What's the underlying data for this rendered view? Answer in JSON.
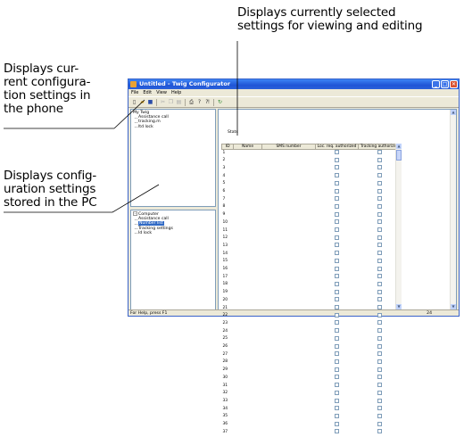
{
  "callouts": {
    "top": [
      "Displays currently selected",
      "settings for viewing and editing"
    ],
    "left1": [
      "Displays cur-",
      "rent configura-",
      "tion settings in",
      "the phone"
    ],
    "left2": [
      "Displays config-",
      "uration settings",
      "stored in the PC"
    ]
  },
  "window": {
    "title": "Untitled - Twig Configurator",
    "controls": {
      "minimize": "_",
      "maximize": "□",
      "close": "✕"
    },
    "menu": [
      "File",
      "Edit",
      "View",
      "Help"
    ],
    "toolbar_icons": [
      "new-file-icon",
      "open-folder-icon",
      "save-icon",
      "cut-icon",
      "copy-icon",
      "paste-icon",
      "print-icon",
      "help-icon",
      "context-help-icon",
      "refresh-icon"
    ]
  },
  "tree_phone": {
    "root": "My Twig",
    "items": [
      "Assistance call",
      "tracking.m",
      "ltd lock"
    ]
  },
  "tree_pc": {
    "root": "Computer",
    "items": [
      "Assistance call",
      "Number list",
      "Tracking settings",
      "Id lock"
    ],
    "selected_index": 1
  },
  "detail": {
    "tab_label": "Stats",
    "columns": [
      "ID",
      "Name",
      "SMS number",
      "Loc. req. authorized",
      "Tracking authorized"
    ],
    "row_ids": [
      "1",
      "2",
      "3",
      "4",
      "5",
      "6",
      "7",
      "8",
      "9",
      "10",
      "11",
      "12",
      "13",
      "14",
      "15",
      "16",
      "17",
      "18",
      "19",
      "20",
      "21",
      "22",
      "23",
      "24",
      "25",
      "26",
      "27",
      "28",
      "29",
      "30",
      "31",
      "32",
      "33",
      "34",
      "35",
      "36",
      "37"
    ]
  },
  "status": {
    "left": "For Help, press F1",
    "right": "24"
  }
}
